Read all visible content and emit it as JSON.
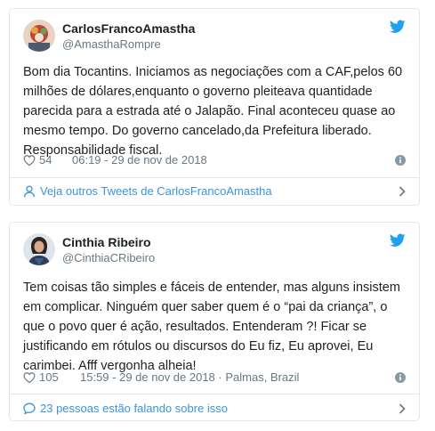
{
  "tweets": [
    {
      "display_name": "CarlosFrancoAmastha",
      "handle": "@AmasthaRompre",
      "text": "Bom dia Tocantins. Iniciamos as negociações com a CAF,pelos 60\nmilhões de dólares,enquanto o governo pleiteava quantidade\nparecida para a estrada até o Jalapão. Final aconteceu quase ao\nmesmo tempo. Do governo cancelado,da Prefeitura liberado.\nResponsabilidade fiscal.",
      "likes": "54",
      "timestamp": "06:19 - 29 de nov de 2018",
      "footer_label": "Veja outros Tweets de CarlosFrancoAmastha",
      "footer_icon": "person-icon",
      "avatar_color": "#b8453e"
    },
    {
      "display_name": "Cinthia Ribeiro",
      "handle": "@CinthiaCRibeiro",
      "text": "Tem coisas tão simples e fáceis de entender, mas alguns insistem\nem complicar. Ninguém quer saber quem é o “pai da criança”, o\nque o povo quer é ação, resultados. Entenderam ?! Ficar se\njustificando em rótulos ou discursos do Eu fiz, Eu aprovei, Eu\ncarimbei. Afff vergonha alheia!",
      "likes": "105",
      "timestamp": "15:59 - 29 de nov de 2018 · Palmas, Brazil",
      "footer_label": "23 pessoas estão falando sobre isso",
      "footer_icon": "speech-bubble-icon",
      "avatar_color": "#2c3e58"
    }
  ],
  "colors": {
    "twitter_blue": "#1da1f2",
    "link_blue": "#3b94d9",
    "meta_gray": "#697882",
    "text": "#1c2022",
    "border": "#e1e8ed"
  }
}
